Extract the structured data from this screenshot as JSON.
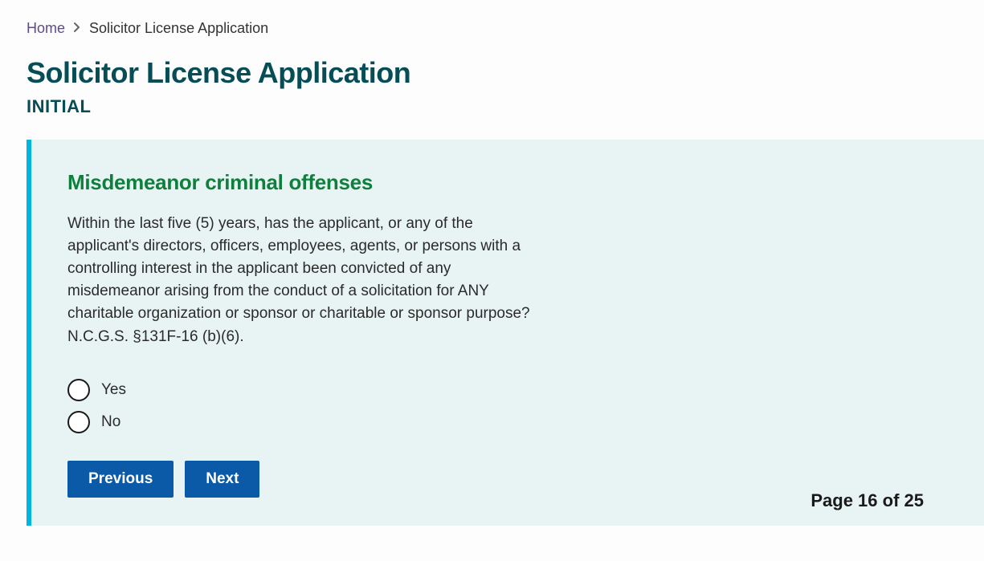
{
  "breadcrumb": {
    "home": "Home",
    "current": "Solicitor License Application"
  },
  "header": {
    "title": "Solicitor License Application",
    "subtitle": "INITIAL"
  },
  "section": {
    "title": "Misdemeanor criminal offenses",
    "question": "Within the last five (5) years, has the applicant, or any of the applicant's directors, officers, employees, agents, or persons with a controlling interest in the applicant been convicted of any misdemeanor arising from the conduct of a solicitation for ANY charitable organization or sponsor or charitable or sponsor purpose? N.C.G.S. §131F-16 (b)(6)."
  },
  "options": {
    "yes": "Yes",
    "no": "No"
  },
  "buttons": {
    "previous": "Previous",
    "next": "Next"
  },
  "pagination": {
    "label": "Page 16 of 25"
  }
}
